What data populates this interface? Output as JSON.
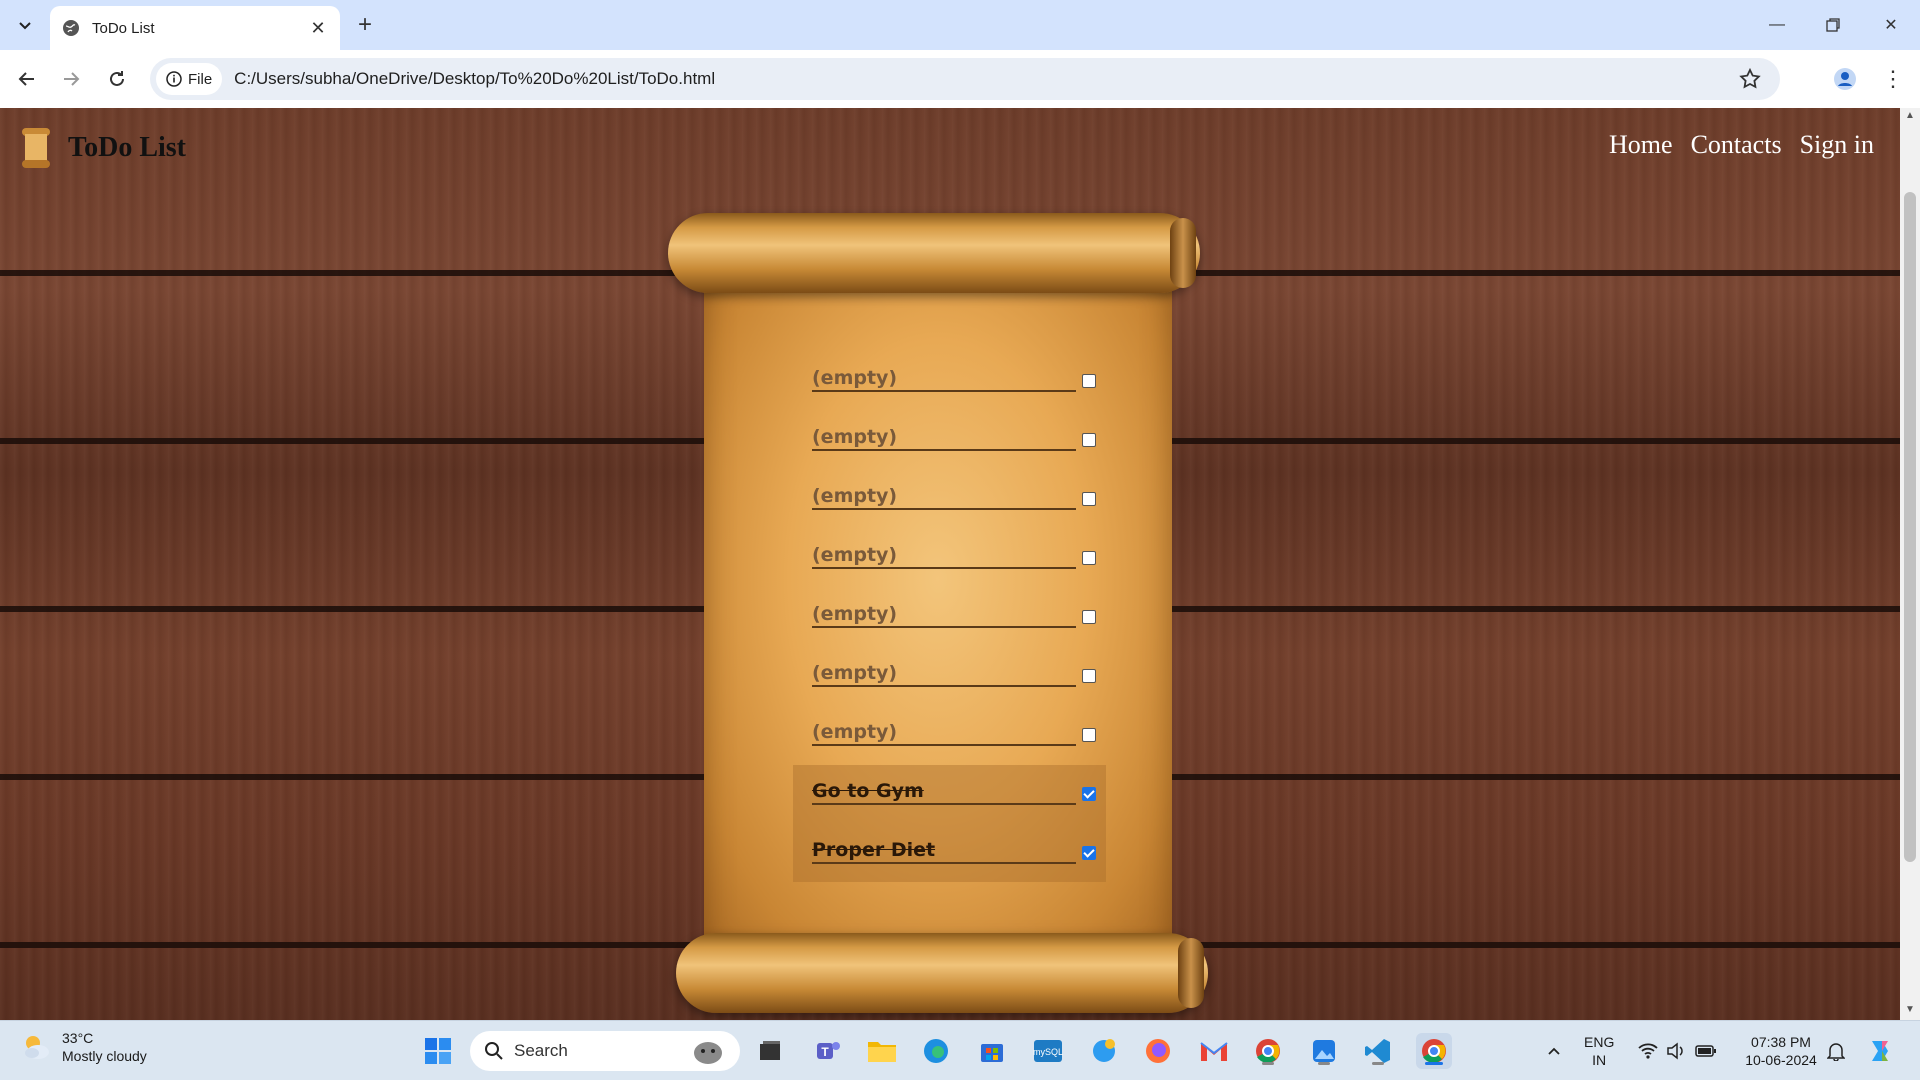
{
  "browser": {
    "tab_title": "ToDo List",
    "site_chip": "File",
    "url": "C:/Users/subha/OneDrive/Desktop/To%20Do%20List/ToDo.html"
  },
  "page": {
    "brand_title": "ToDo List",
    "nav": [
      "Home",
      "Contacts",
      "Sign in"
    ],
    "todos": [
      {
        "text": "(empty)",
        "checked": false
      },
      {
        "text": "(empty)",
        "checked": false
      },
      {
        "text": "(empty)",
        "checked": false
      },
      {
        "text": "(empty)",
        "checked": false
      },
      {
        "text": "(empty)",
        "checked": false
      },
      {
        "text": "(empty)",
        "checked": false
      },
      {
        "text": "(empty)",
        "checked": false
      },
      {
        "text": "Go to Gym",
        "checked": true
      },
      {
        "text": "Proper Diet",
        "checked": true
      }
    ]
  },
  "taskbar": {
    "temperature": "33°C",
    "weather": "Mostly cloudy",
    "search_label": "Search",
    "lang_top": "ENG",
    "lang_bottom": "IN",
    "time": "07:38 PM",
    "date": "10-06-2024"
  },
  "colors": {
    "checkbox_checked": "#1a73e8",
    "nav_text": "#ffffff"
  }
}
